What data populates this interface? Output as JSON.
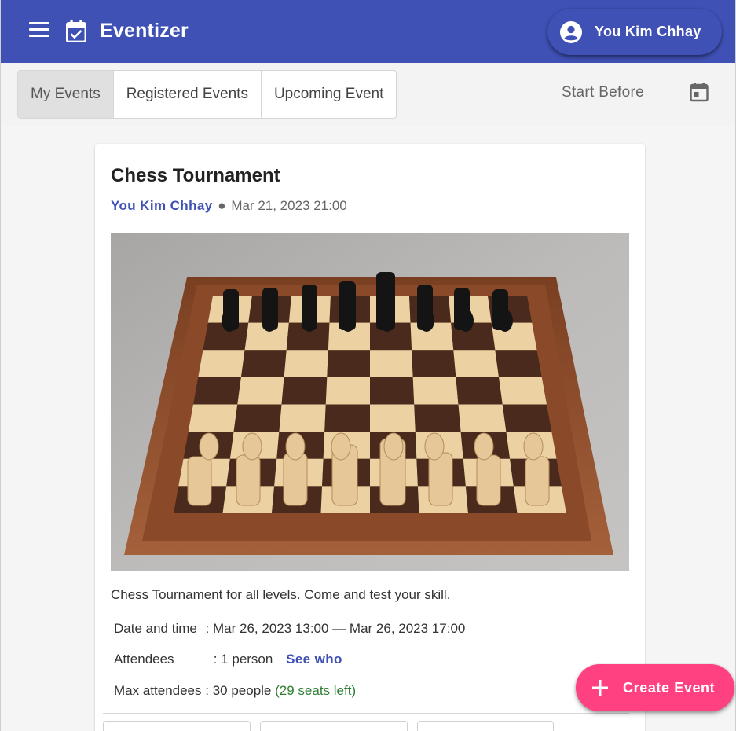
{
  "app": {
    "title": "Eventizer",
    "user_name": "You Kim Chhay",
    "brand_color": "#3f51b5",
    "accent_color": "#ff4081"
  },
  "icons": {
    "menu": "menu-icon",
    "logo": "calendar-check-icon",
    "avatar": "account-circle-icon",
    "date_picker": "calendar-icon",
    "fab": "plus-icon"
  },
  "tabs": [
    {
      "label": "My Events",
      "active": true
    },
    {
      "label": "Registered Events",
      "active": false
    },
    {
      "label": "Upcoming Event",
      "active": false
    }
  ],
  "filter": {
    "start_before_label": "Start Before"
  },
  "event": {
    "title": "Chess Tournament",
    "organizer": "You Kim Chhay",
    "separator": "●",
    "posted_at": "Mar 21, 2023 21:00",
    "image_alt": "chessboard-photo",
    "description": "Chess Tournament for all levels. Come and test your skill.",
    "date_label": "Date and time",
    "date_value": ": Mar 26, 2023 13:00 — Mar 26, 2023 17:00",
    "attendees_label": "Attendees",
    "attendees_value": ": 1 person",
    "see_who": "See who",
    "max_label": "Max attendees",
    "max_value": ": 30 people",
    "seats_left": "(29 seats left)",
    "seats_color": "#2e7d32"
  },
  "fab": {
    "label": "Create Event"
  }
}
